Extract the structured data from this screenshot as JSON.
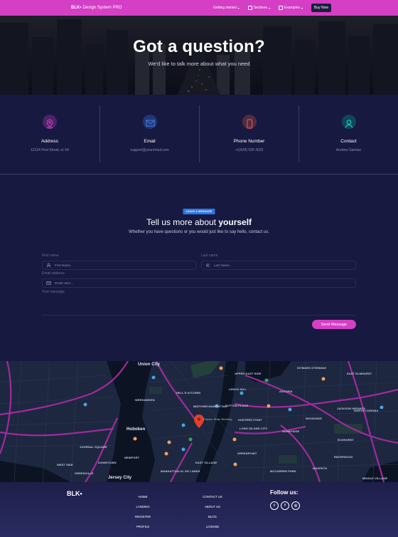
{
  "navbar": {
    "brand_bold": "BLK•",
    "brand_text": "Design System PRO",
    "items": [
      {
        "label": "Getting started"
      },
      {
        "label": "Sections"
      },
      {
        "label": "Examples"
      }
    ],
    "buy_label": "Buy Now"
  },
  "hero": {
    "title": "Got a question?",
    "subtitle": "We'd like to talk more about what you need"
  },
  "info": [
    {
      "title": "Address",
      "value": "12124 First Street, nr 54",
      "icon": "map-pin-icon",
      "color": "#d43fc5"
    },
    {
      "title": "Email",
      "value": "support@youremail.com",
      "icon": "envelope-icon",
      "color": "#3f7fe8"
    },
    {
      "title": "Phone Number",
      "value": "+1(424) 535 3523",
      "icon": "phone-icon",
      "color": "#f5593d"
    },
    {
      "title": "Contact",
      "value": "Andrew Samian",
      "icon": "user-icon",
      "color": "#00f2c3"
    }
  ],
  "form": {
    "badge": "LEAVE A MESSAGE",
    "title_regular": "Tell us more about",
    "title_bold": "yourself",
    "subtitle": "Whether you have questions or you would just like to say hello, contact us.",
    "first_name_label": "First name",
    "first_name_placeholder": "First Name...",
    "last_name_label": "Last name",
    "last_name_placeholder": "Last Name...",
    "email_label": "Email address",
    "email_placeholder": "Email Here...",
    "message_label": "Your message",
    "send_label": "Send Message"
  },
  "map": {
    "labels": {
      "union_city": "Union City",
      "hells_kitchen": "HELL'S KITCHEN",
      "midtown": "MIDTOWN MANHATTAN",
      "jersey_city": "Jersey City",
      "astoria": "ASTORIA",
      "long_island_city": "LONG ISLAND CITY",
      "sunnyside": "SUNNYSIDE",
      "greenpoint": "GREENPOINT",
      "east_village": "EAST VILLAGE",
      "woodside": "WOODSIDE",
      "jackson_heights": "JACKSON HEIGHTS",
      "north_corona": "NORTH CORONA",
      "elmhurst": "ELMHURST",
      "maspeth": "MASPETH",
      "upper_east_side": "UPPER EAST SIDE",
      "lenox_hill": "LENOX HILL",
      "sutton_place": "SUTTON PLACE",
      "hunters_point": "HUNTERS POINT",
      "hoboken": "Hoboken",
      "weehawken": "WEEHAWKEN",
      "newport": "NEWPORT",
      "west_side": "WEST SIDE",
      "journal_square": "JOURNAL SQUARE",
      "east_elmhurst": "EAST ELMHURST",
      "middle_village": "MIDDLE VILLAGE",
      "ridgewood": "RIDGEWOOD",
      "downtown": "DOWNTOWN",
      "greenville": "GREENVILLE",
      "lower_manhattan": "MANHATTAN-OL DE LANDS",
      "ditmars": "DITMARS STEINWAY",
      "mccarren": "MCCARREN PARK",
      "empire_state": "Empire State Building"
    }
  },
  "footer": {
    "logo": "BLK•",
    "col1": [
      "HOME",
      "LANDING",
      "REGISTER",
      "PROFILE"
    ],
    "col2": [
      "CONTACT US",
      "ABOUT US",
      "BLOG",
      "LICENSE"
    ],
    "follow": "Follow us:",
    "social": [
      {
        "icon": "twitter-icon",
        "glyph": "t"
      },
      {
        "icon": "facebook-icon",
        "glyph": "f"
      },
      {
        "icon": "dribbble-icon",
        "glyph": "◎"
      }
    ]
  },
  "colors": {
    "accent": "#d43fc5",
    "background": "#171941",
    "badge": "#2a78e8"
  }
}
